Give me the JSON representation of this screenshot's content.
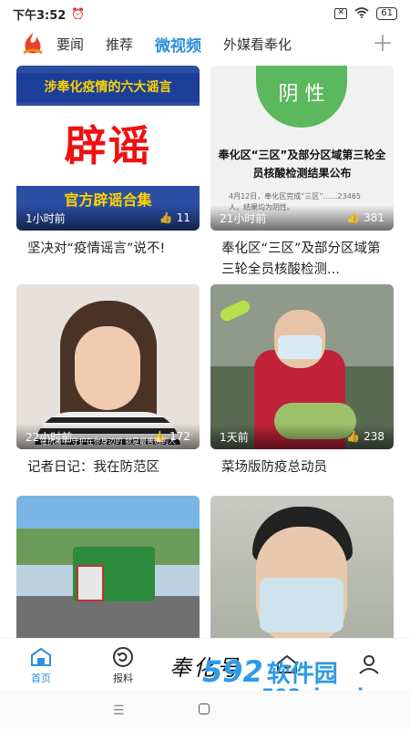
{
  "status_bar": {
    "time": "下午3:52",
    "battery": "61"
  },
  "tabs": [
    {
      "label": "要闻"
    },
    {
      "label": "推荐"
    },
    {
      "label": "微视频"
    },
    {
      "label": "外媒看奉化"
    }
  ],
  "active_tab": "微视频",
  "cards": [
    {
      "overlay_banner": "涉奉化疫情的六大谣言",
      "overlay_big": "辟谣",
      "overlay_sub": "官方辟谣合集",
      "time_ago": "1小时前",
      "likes": "11",
      "caption": "坚决对“疫情谣言”说不!"
    },
    {
      "overlay_badge": "阴 性",
      "overlay_title": "奉化区“三区”及部分区域第三轮全员核酸检测结果公布",
      "overlay_fine": "4月12日，奉化区完成“三区”……23465人，结果均为阴性。",
      "time_ago": "21小时前",
      "likes": "381",
      "caption": "奉化区“三区”及部分区域第三轮全员核酸检测..."
    },
    {
      "overlay_subtitle": "在抗疫中 守护在你身边的 就是最普通的人",
      "time_ago": "22小时前",
      "likes": "172",
      "caption": "记者日记：我在防范区"
    },
    {
      "time_ago": "1天前",
      "likes": "238",
      "caption": "菜场版防疫总动员"
    },
    {
      "time_ago": "",
      "likes": "",
      "caption": ""
    },
    {
      "time_ago": "",
      "likes": "",
      "caption": ""
    }
  ],
  "bottom_nav": {
    "home_label": "首页",
    "report_label": "报料",
    "brand": "奉化号"
  },
  "watermark": {
    "number": "592",
    "cn": "软件园",
    "url": "www.592xiazai.com"
  },
  "colors": {
    "accent": "#2f8fe0",
    "watermark": "#2f9ae8"
  }
}
